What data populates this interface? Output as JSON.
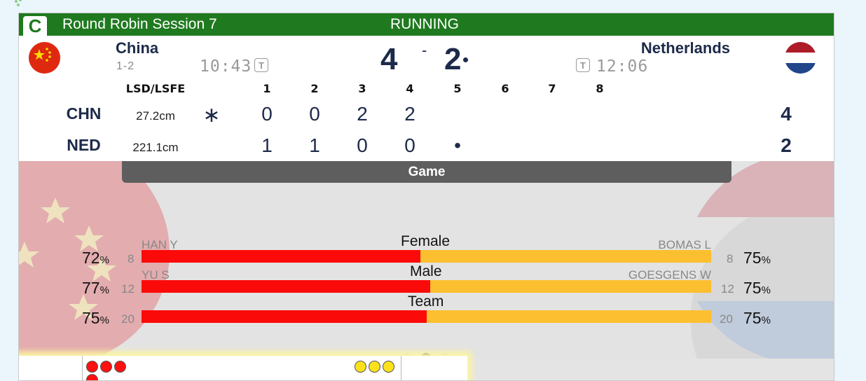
{
  "header": {
    "badge": "C",
    "title": "Round Robin Session 7",
    "status": "RUNNING"
  },
  "teams": {
    "home": {
      "name": "China",
      "record": "1-2",
      "time": "10:43",
      "score": "4",
      "code": "CHN",
      "lsd": "27.2cm",
      "ends": [
        "0",
        "0",
        "2",
        "2",
        "",
        "",
        "",
        ""
      ],
      "total": "4",
      "flag": "china-flag"
    },
    "away": {
      "name": "Netherlands",
      "time": "12:06",
      "score": "2",
      "code": "NED",
      "lsd": "221.1cm",
      "ends": [
        "1",
        "1",
        "0",
        "0",
        "",
        "",
        "",
        ""
      ],
      "total": "2",
      "flag": "netherlands-flag"
    }
  },
  "score_separator": "-",
  "timeout_label": "T",
  "ends_table": {
    "lsd_header": "LSD/LSFE",
    "end_headers": [
      "1",
      "2",
      "3",
      "4",
      "5",
      "6",
      "7",
      "8"
    ],
    "hammer_symbol": "∗",
    "current_end_marker": "•"
  },
  "stats": {
    "tab_label": "Game",
    "rows": [
      {
        "label": "Female",
        "home_player": "HAN Y",
        "away_player": "BOMAS L",
        "home_pct": "72",
        "away_pct": "75",
        "home_shots": "8",
        "away_shots": "8",
        "home_share": 0.49
      },
      {
        "label": "Male",
        "home_player": "YU S",
        "away_player": "GOESGENS W",
        "home_pct": "77",
        "away_pct": "75",
        "home_shots": "12",
        "away_shots": "12",
        "home_share": 0.507
      },
      {
        "label": "Team",
        "home_player": "",
        "away_player": "",
        "home_pct": "75",
        "away_pct": "75",
        "home_shots": "20",
        "away_shots": "20",
        "home_share": 0.5
      }
    ],
    "percent_symbol": "%"
  },
  "pager": {
    "pages": 5,
    "active": 3
  },
  "colors": {
    "header_green": "#1f7a1f",
    "home_bar": "#fb0a0a",
    "away_bar": "#fcbf2f",
    "text_navy": "#1d2a4a"
  },
  "stones": {
    "red_count": 4,
    "yellow_count": 3
  }
}
